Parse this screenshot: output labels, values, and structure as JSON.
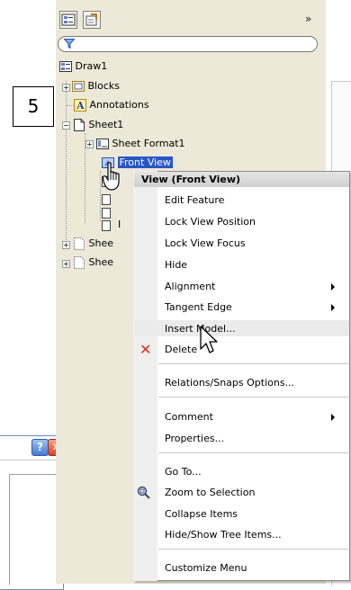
{
  "background_dialog": {
    "help_glyph": "?",
    "close_glyph": "✕"
  },
  "panel": {
    "chevron": "»"
  },
  "callout": "5",
  "tree": {
    "root": "Draw1",
    "blocks": "Blocks",
    "annotations": "Annotations",
    "sheet1": "Sheet1",
    "sheet_format": "Sheet Format1",
    "front_view": "Front View",
    "partial_child": "I",
    "sheet2_partial": "Shee",
    "sheet3_partial": "Shee"
  },
  "context_menu": {
    "header": "View (Front View)",
    "items": [
      {
        "label": "Edit Feature"
      },
      {
        "label": "Lock View Position"
      },
      {
        "label": "Lock View Focus"
      },
      {
        "label": "Hide"
      },
      {
        "label": "Alignment",
        "submenu": true
      },
      {
        "label": "Tangent Edge",
        "submenu": true
      },
      {
        "label": "Insert Model...",
        "highlighted": true
      },
      {
        "label": "Delete",
        "icon": "red-x-icon"
      },
      {
        "label": "Relations/Snaps Options..."
      },
      {
        "label": "Comment",
        "submenu": true
      },
      {
        "label": "Properties..."
      },
      {
        "label": "Go To..."
      },
      {
        "label": "Zoom to Selection",
        "icon": "zoom-to-selection-icon"
      },
      {
        "label": "Collapse Items"
      },
      {
        "label": "Hide/Show Tree Items..."
      },
      {
        "label": "Customize Menu"
      }
    ]
  },
  "colors": {
    "selection": "#2a56c6",
    "panel_bg": "#ece9d8",
    "delete_red": "#e0301e"
  }
}
